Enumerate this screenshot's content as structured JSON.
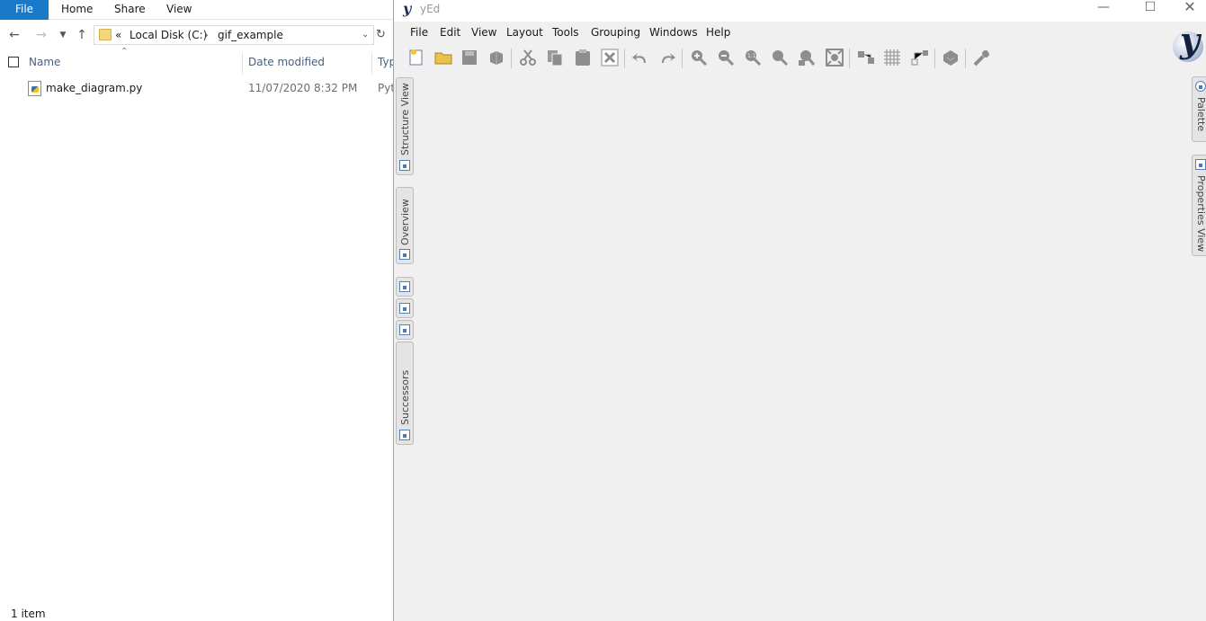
{
  "explorer": {
    "ribbon": {
      "tabs": [
        "File",
        "Home",
        "Share",
        "View"
      ]
    },
    "address": {
      "overflow": "«",
      "crumbs": [
        "Local Disk (C:)",
        "gif_example"
      ]
    },
    "columns": {
      "name": "Name",
      "date_modified": "Date modified",
      "type": "Typ"
    },
    "files": [
      {
        "name": "make_diagram.py",
        "date": "11/07/2020 8:32 PM",
        "type": "Pyt"
      }
    ],
    "status": "1 item"
  },
  "yed": {
    "title": "yEd",
    "menu": [
      "File",
      "Edit",
      "View",
      "Layout",
      "Tools",
      "Grouping",
      "Windows",
      "Help"
    ],
    "toolbar_icons": [
      "new-document-icon",
      "open-folder-icon",
      "save-icon",
      "export-icon",
      "cut-icon",
      "copy-icon",
      "paste-icon",
      "delete-icon",
      "undo-icon",
      "redo-icon",
      "zoom-in-icon",
      "zoom-out-icon",
      "zoom-original-icon",
      "zoom-area-icon",
      "zoom-selection-icon",
      "fit-content-icon",
      "snap-lines-icon",
      "grid-icon",
      "orthogonal-edges-icon",
      "layout-icon",
      "tools-icon"
    ],
    "left_tabs": [
      "Structure View",
      "Overview",
      "Successors"
    ],
    "right_tabs": [
      "Palette",
      "Properties View"
    ]
  }
}
